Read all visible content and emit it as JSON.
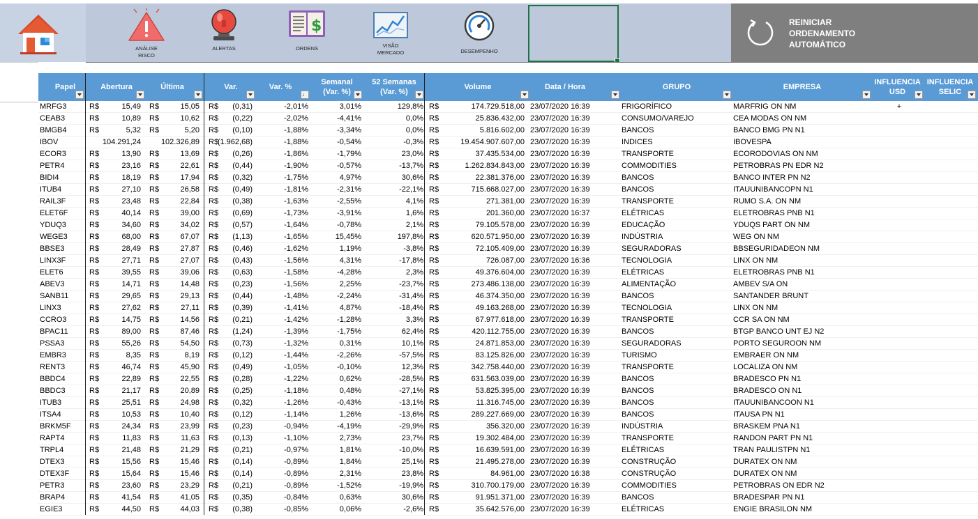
{
  "ribbon": {
    "items": [
      {
        "label": "ANÁLISE\nRISCO",
        "icon": "warning-icon"
      },
      {
        "label": "ALERTAS",
        "icon": "alarm-bell-icon"
      },
      {
        "label": "ORDENS",
        "icon": "orders-ledger-icon"
      },
      {
        "label": "VISÃO\nMERCADO",
        "icon": "market-chart-icon"
      },
      {
        "label": "DESEMPENHO",
        "icon": "gauge-icon"
      }
    ],
    "home_icon": "home-icon",
    "reset_label": "REINICIAR ORDENAMENTO AUTOMÁTICO",
    "reset_icon": "refresh-icon"
  },
  "colors": {
    "header_bg": "#5b9bd5",
    "ribbon_bg": "#bdc9da",
    "reset_bg": "#7f7f7f"
  },
  "table": {
    "headers": {
      "papel": "Papel",
      "abertura": "Abertura",
      "ultima": "Última",
      "var": "Var.",
      "var_pct": "Var. %",
      "semanal": "Semanal\n(Var. %)",
      "semanas52": "52 Semanas\n(Var. %)",
      "volume": "Volume",
      "data_hora": "Data / Hora",
      "grupo": "GRUPO",
      "empresa": "EMPRESA",
      "influencia_usd": "INFLUENCIA\nUSD",
      "influencia_selic": "INFLUENCIA\nSELIC"
    },
    "currency": "R$",
    "rows": [
      [
        "MRFG3",
        "15,49",
        "15,05",
        "(0,31)",
        "-2,01%",
        "3,01%",
        "129,8%",
        "174.729.518,00",
        "23/07/2020 16:39",
        "FRIGORÍFICO",
        "MARFRIG ON NM",
        "+",
        ""
      ],
      [
        "CEAB3",
        "10,89",
        "10,62",
        "(0,22)",
        "-2,02%",
        "-4,41%",
        "0,0%",
        "25.836.432,00",
        "23/07/2020 16:39",
        "CONSUMO/VAREJO",
        "CEA MODAS ON NM",
        "",
        ""
      ],
      [
        "BMGB4",
        "5,32",
        "5,20",
        "(0,10)",
        "-1,88%",
        "-3,34%",
        "0,0%",
        "5.816.602,00",
        "23/07/2020 16:39",
        "BANCOS",
        "BANCO BMG PN N1",
        "",
        ""
      ],
      [
        "IBOV",
        "104.291,24",
        "102.326,89",
        "(1.962,68)",
        "-1,88%",
        "-0,54%",
        "-0,3%",
        "19.454.907.607,00",
        "23/07/2020 16:39",
        "INDICES",
        "IBOVESPA",
        "",
        ""
      ],
      [
        "ECOR3",
        "13,90",
        "13,69",
        "(0,26)",
        "-1,86%",
        "-1,79%",
        "23,0%",
        "37.435.534,00",
        "23/07/2020 16:39",
        "TRANSPORTE",
        "ECORODOVIAS ON NM",
        "",
        ""
      ],
      [
        "PETR4",
        "23,16",
        "22,61",
        "(0,44)",
        "-1,90%",
        "-0,57%",
        "-13,7%",
        "1.262.834.843,00",
        "23/07/2020 16:39",
        "COMMODITIES",
        "PETROBRAS PN EDR N2",
        "",
        ""
      ],
      [
        "BIDI4",
        "18,19",
        "17,94",
        "(0,32)",
        "-1,75%",
        "4,97%",
        "30,6%",
        "22.381.376,00",
        "23/07/2020 16:39",
        "BANCOS",
        "BANCO INTER PN N2",
        "",
        ""
      ],
      [
        "ITUB4",
        "27,10",
        "26,58",
        "(0,49)",
        "-1,81%",
        "-2,31%",
        "-22,1%",
        "715.668.027,00",
        "23/07/2020 16:39",
        "BANCOS",
        "ITAUUNIBANCOPN N1",
        "",
        ""
      ],
      [
        "RAIL3F",
        "23,48",
        "22,84",
        "(0,38)",
        "-1,63%",
        "-2,55%",
        "4,1%",
        "271.381,00",
        "23/07/2020 16:39",
        "TRANSPORTE",
        "RUMO S.A. ON NM",
        "",
        ""
      ],
      [
        "ELET6F",
        "40,14",
        "39,00",
        "(0,69)",
        "-1,73%",
        "-3,91%",
        "1,6%",
        "201.360,00",
        "23/07/2020 16:37",
        "ELÉTRICAS",
        "ELETROBRAS PNB N1",
        "",
        ""
      ],
      [
        "YDUQ3",
        "34,60",
        "34,02",
        "(0,57)",
        "-1,64%",
        "-0,78%",
        "2,1%",
        "79.105.578,00",
        "23/07/2020 16:39",
        "EDUCAÇÃO",
        "YDUQS PART ON NM",
        "",
        ""
      ],
      [
        "WEGE3",
        "68,00",
        "67,07",
        "(1,13)",
        "-1,65%",
        "15,45%",
        "197,8%",
        "620.571.950,00",
        "23/07/2020 16:39",
        "INDÚSTRIA",
        "WEG ON NM",
        "",
        ""
      ],
      [
        "BBSE3",
        "28,49",
        "27,87",
        "(0,46)",
        "-1,62%",
        "1,19%",
        "-3,8%",
        "72.105.409,00",
        "23/07/2020 16:39",
        "SEGURADORAS",
        "BBSEGURIDADEON NM",
        "",
        ""
      ],
      [
        "LINX3F",
        "27,71",
        "27,07",
        "(0,43)",
        "-1,56%",
        "4,31%",
        "-17,8%",
        "726.087,00",
        "23/07/2020 16:36",
        "TECNOLOGIA",
        "LINX ON NM",
        "",
        ""
      ],
      [
        "ELET6",
        "39,55",
        "39,06",
        "(0,63)",
        "-1,58%",
        "-4,28%",
        "2,3%",
        "49.376.604,00",
        "23/07/2020 16:39",
        "ELÉTRICAS",
        "ELETROBRAS PNB N1",
        "",
        ""
      ],
      [
        "ABEV3",
        "14,71",
        "14,48",
        "(0,23)",
        "-1,56%",
        "2,25%",
        "-23,7%",
        "273.486.138,00",
        "23/07/2020 16:39",
        "ALIMENTAÇÃO",
        "AMBEV S/A ON",
        "",
        ""
      ],
      [
        "SANB11",
        "29,65",
        "29,13",
        "(0,44)",
        "-1,48%",
        "-2,24%",
        "-31,4%",
        "46.374.350,00",
        "23/07/2020 16:39",
        "BANCOS",
        "SANTANDER BRUNT",
        "",
        ""
      ],
      [
        "LINX3",
        "27,62",
        "27,11",
        "(0,39)",
        "-1,41%",
        "4,87%",
        "-18,4%",
        "49.163.268,00",
        "23/07/2020 16:39",
        "TECNOLOGIA",
        "LINX ON NM",
        "",
        ""
      ],
      [
        "CCRO3",
        "14,75",
        "14,56",
        "(0,21)",
        "-1,42%",
        "-1,28%",
        "3,3%",
        "67.977.618,00",
        "23/07/2020 16:39",
        "TRANSPORTE",
        "CCR SA ON NM",
        "",
        ""
      ],
      [
        "BPAC11",
        "89,00",
        "87,46",
        "(1,24)",
        "-1,39%",
        "-1,75%",
        "62,4%",
        "420.112.755,00",
        "23/07/2020 16:39",
        "BANCOS",
        "BTGP BANCO UNT EJ N2",
        "",
        ""
      ],
      [
        "PSSA3",
        "55,26",
        "54,50",
        "(0,73)",
        "-1,32%",
        "0,31%",
        "10,1%",
        "24.871.853,00",
        "23/07/2020 16:39",
        "SEGURADORAS",
        "PORTO SEGUROON NM",
        "",
        ""
      ],
      [
        "EMBR3",
        "8,35",
        "8,19",
        "(0,12)",
        "-1,44%",
        "-2,26%",
        "-57,5%",
        "83.125.826,00",
        "23/07/2020 16:39",
        "TURISMO",
        "EMBRAER ON NM",
        "",
        ""
      ],
      [
        "RENT3",
        "46,74",
        "45,90",
        "(0,49)",
        "-1,05%",
        "-0,10%",
        "12,3%",
        "342.758.440,00",
        "23/07/2020 16:39",
        "TRANSPORTE",
        "LOCALIZA ON NM",
        "",
        ""
      ],
      [
        "BBDC4",
        "22,89",
        "22,55",
        "(0,28)",
        "-1,22%",
        "0,62%",
        "-28,5%",
        "631.563.039,00",
        "23/07/2020 16:39",
        "BANCOS",
        "BRADESCO PN N1",
        "",
        ""
      ],
      [
        "BBDC3",
        "21,17",
        "20,89",
        "(0,25)",
        "-1,18%",
        "0,48%",
        "-27,1%",
        "53.825.395,00",
        "23/07/2020 16:39",
        "BANCOS",
        "BRADESCO ON N1",
        "",
        ""
      ],
      [
        "ITUB3",
        "25,51",
        "24,98",
        "(0,32)",
        "-1,26%",
        "-0,43%",
        "-13,1%",
        "11.316.745,00",
        "23/07/2020 16:39",
        "BANCOS",
        "ITAUUNIBANCOON N1",
        "",
        ""
      ],
      [
        "ITSA4",
        "10,53",
        "10,40",
        "(0,12)",
        "-1,14%",
        "1,26%",
        "-13,6%",
        "289.227.669,00",
        "23/07/2020 16:39",
        "BANCOS",
        "ITAUSA PN N1",
        "",
        ""
      ],
      [
        "BRKM5F",
        "24,34",
        "23,99",
        "(0,23)",
        "-0,94%",
        "-4,19%",
        "-29,9%",
        "356.320,00",
        "23/07/2020 16:39",
        "INDÚSTRIA",
        "BRASKEM PNA N1",
        "",
        ""
      ],
      [
        "RAPT4",
        "11,83",
        "11,63",
        "(0,13)",
        "-1,10%",
        "2,73%",
        "23,7%",
        "19.302.484,00",
        "23/07/2020 16:39",
        "TRANSPORTE",
        "RANDON PART PN N1",
        "",
        ""
      ],
      [
        "TRPL4",
        "21,48",
        "21,29",
        "(0,21)",
        "-0,97%",
        "1,81%",
        "-10,0%",
        "16.639.591,00",
        "23/07/2020 16:39",
        "ELÉTRICAS",
        "TRAN PAULISTPN N1",
        "",
        ""
      ],
      [
        "DTEX3",
        "15,56",
        "15,46",
        "(0,14)",
        "-0,89%",
        "1,84%",
        "25,1%",
        "21.495.278,00",
        "23/07/2020 16:39",
        "CONSTRUÇÃO",
        "DURATEX ON NM",
        "",
        ""
      ],
      [
        "DTEX3F",
        "15,64",
        "15,46",
        "(0,14)",
        "-0,89%",
        "2,31%",
        "23,8%",
        "84.961,00",
        "23/07/2020 16:38",
        "CONSTRUÇÃO",
        "DURATEX ON NM",
        "",
        ""
      ],
      [
        "PETR3",
        "23,60",
        "23,29",
        "(0,21)",
        "-0,89%",
        "-1,52%",
        "-19,9%",
        "310.700.179,00",
        "23/07/2020 16:39",
        "COMMODITIES",
        "PETROBRAS ON EDR N2",
        "",
        ""
      ],
      [
        "BRAP4",
        "41,54",
        "41,05",
        "(0,35)",
        "-0,84%",
        "0,63%",
        "30,6%",
        "91.951.371,00",
        "23/07/2020 16:39",
        "BANCOS",
        "BRADESPAR PN N1",
        "",
        ""
      ],
      [
        "EGIE3",
        "44,50",
        "44,03",
        "(0,38)",
        "-0,85%",
        "0,06%",
        "-2,6%",
        "35.642.576,00",
        "23/07/2020 16:39",
        "ELÉTRICAS",
        "ENGIE BRASILON NM",
        "",
        ""
      ]
    ]
  }
}
